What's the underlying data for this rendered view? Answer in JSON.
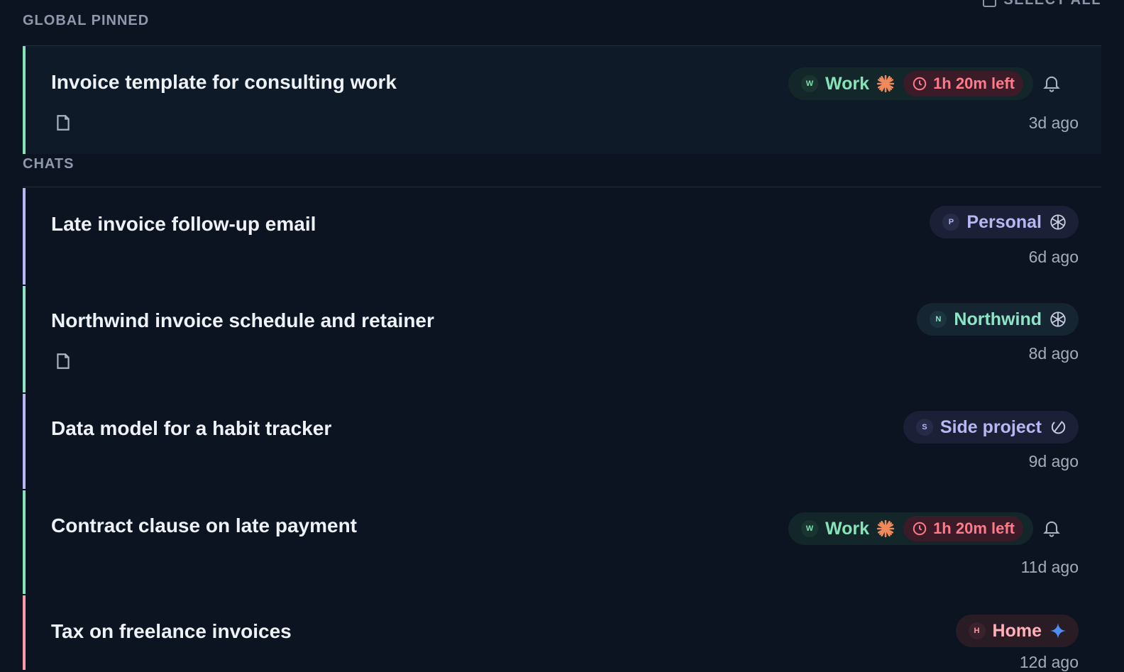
{
  "header": {
    "select_all_label": "SELECT ALL"
  },
  "sections": {
    "pinned_label": "GLOBAL PINNED",
    "chats_label": "CHATS"
  },
  "timer_label": "1h 20m left",
  "colors": {
    "background": "#0c1421",
    "work": "#86e3b8",
    "personal": "#b8b6f3",
    "northwind": "#8fe3c8",
    "side_project": "#b8b6f3",
    "home": "#ffb0b8",
    "timer": "#ff7a8a"
  },
  "pinned": [
    {
      "title": "Invoice template for consulting work",
      "tag": {
        "initial": "W",
        "label": "Work",
        "model_icon": "claude-sparkle-icon"
      },
      "timer": "1h 20m left",
      "has_document": true,
      "has_reminder": true,
      "time": "3d ago"
    }
  ],
  "chats": [
    {
      "title": "Late invoice follow-up email",
      "tag": {
        "initial": "P",
        "label": "Personal",
        "model_icon": "openai-knot-icon"
      },
      "time": "6d ago"
    },
    {
      "title": "Northwind invoice schedule and retainer",
      "tag": {
        "initial": "N",
        "label": "Northwind",
        "model_icon": "openai-knot-icon"
      },
      "has_document": true,
      "time": "8d ago"
    },
    {
      "title": "Data model for a habit tracker",
      "tag": {
        "initial": "S",
        "label": "Side project",
        "model_icon": "loop-icon"
      },
      "time": "9d ago"
    },
    {
      "title": "Contract clause on late payment",
      "tag": {
        "initial": "W",
        "label": "Work",
        "model_icon": "claude-sparkle-icon"
      },
      "timer": "1h 20m left",
      "has_reminder": true,
      "time": "11d ago"
    },
    {
      "title": "Tax on freelance invoices",
      "tag": {
        "initial": "H",
        "label": "Home",
        "model_icon": "gemini-star-icon"
      },
      "time": "12d ago"
    }
  ]
}
